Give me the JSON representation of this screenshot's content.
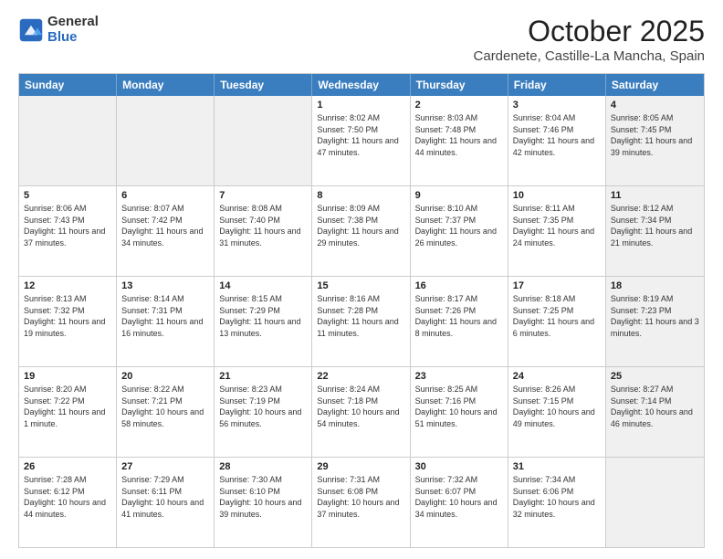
{
  "logo": {
    "general": "General",
    "blue": "Blue"
  },
  "title": "October 2025",
  "location": "Cardenete, Castille-La Mancha, Spain",
  "header_days": [
    "Sunday",
    "Monday",
    "Tuesday",
    "Wednesday",
    "Thursday",
    "Friday",
    "Saturday"
  ],
  "weeks": [
    [
      {
        "day": "",
        "text": "",
        "shaded": true
      },
      {
        "day": "",
        "text": "",
        "shaded": true
      },
      {
        "day": "",
        "text": "",
        "shaded": true
      },
      {
        "day": "1",
        "text": "Sunrise: 8:02 AM\nSunset: 7:50 PM\nDaylight: 11 hours and 47 minutes."
      },
      {
        "day": "2",
        "text": "Sunrise: 8:03 AM\nSunset: 7:48 PM\nDaylight: 11 hours and 44 minutes."
      },
      {
        "day": "3",
        "text": "Sunrise: 8:04 AM\nSunset: 7:46 PM\nDaylight: 11 hours and 42 minutes."
      },
      {
        "day": "4",
        "text": "Sunrise: 8:05 AM\nSunset: 7:45 PM\nDaylight: 11 hours and 39 minutes.",
        "shaded": true
      }
    ],
    [
      {
        "day": "5",
        "text": "Sunrise: 8:06 AM\nSunset: 7:43 PM\nDaylight: 11 hours and 37 minutes."
      },
      {
        "day": "6",
        "text": "Sunrise: 8:07 AM\nSunset: 7:42 PM\nDaylight: 11 hours and 34 minutes."
      },
      {
        "day": "7",
        "text": "Sunrise: 8:08 AM\nSunset: 7:40 PM\nDaylight: 11 hours and 31 minutes."
      },
      {
        "day": "8",
        "text": "Sunrise: 8:09 AM\nSunset: 7:38 PM\nDaylight: 11 hours and 29 minutes."
      },
      {
        "day": "9",
        "text": "Sunrise: 8:10 AM\nSunset: 7:37 PM\nDaylight: 11 hours and 26 minutes."
      },
      {
        "day": "10",
        "text": "Sunrise: 8:11 AM\nSunset: 7:35 PM\nDaylight: 11 hours and 24 minutes."
      },
      {
        "day": "11",
        "text": "Sunrise: 8:12 AM\nSunset: 7:34 PM\nDaylight: 11 hours and 21 minutes.",
        "shaded": true
      }
    ],
    [
      {
        "day": "12",
        "text": "Sunrise: 8:13 AM\nSunset: 7:32 PM\nDaylight: 11 hours and 19 minutes."
      },
      {
        "day": "13",
        "text": "Sunrise: 8:14 AM\nSunset: 7:31 PM\nDaylight: 11 hours and 16 minutes."
      },
      {
        "day": "14",
        "text": "Sunrise: 8:15 AM\nSunset: 7:29 PM\nDaylight: 11 hours and 13 minutes."
      },
      {
        "day": "15",
        "text": "Sunrise: 8:16 AM\nSunset: 7:28 PM\nDaylight: 11 hours and 11 minutes."
      },
      {
        "day": "16",
        "text": "Sunrise: 8:17 AM\nSunset: 7:26 PM\nDaylight: 11 hours and 8 minutes."
      },
      {
        "day": "17",
        "text": "Sunrise: 8:18 AM\nSunset: 7:25 PM\nDaylight: 11 hours and 6 minutes."
      },
      {
        "day": "18",
        "text": "Sunrise: 8:19 AM\nSunset: 7:23 PM\nDaylight: 11 hours and 3 minutes.",
        "shaded": true
      }
    ],
    [
      {
        "day": "19",
        "text": "Sunrise: 8:20 AM\nSunset: 7:22 PM\nDaylight: 11 hours and 1 minute."
      },
      {
        "day": "20",
        "text": "Sunrise: 8:22 AM\nSunset: 7:21 PM\nDaylight: 10 hours and 58 minutes."
      },
      {
        "day": "21",
        "text": "Sunrise: 8:23 AM\nSunset: 7:19 PM\nDaylight: 10 hours and 56 minutes."
      },
      {
        "day": "22",
        "text": "Sunrise: 8:24 AM\nSunset: 7:18 PM\nDaylight: 10 hours and 54 minutes."
      },
      {
        "day": "23",
        "text": "Sunrise: 8:25 AM\nSunset: 7:16 PM\nDaylight: 10 hours and 51 minutes."
      },
      {
        "day": "24",
        "text": "Sunrise: 8:26 AM\nSunset: 7:15 PM\nDaylight: 10 hours and 49 minutes."
      },
      {
        "day": "25",
        "text": "Sunrise: 8:27 AM\nSunset: 7:14 PM\nDaylight: 10 hours and 46 minutes.",
        "shaded": true
      }
    ],
    [
      {
        "day": "26",
        "text": "Sunrise: 7:28 AM\nSunset: 6:12 PM\nDaylight: 10 hours and 44 minutes."
      },
      {
        "day": "27",
        "text": "Sunrise: 7:29 AM\nSunset: 6:11 PM\nDaylight: 10 hours and 41 minutes."
      },
      {
        "day": "28",
        "text": "Sunrise: 7:30 AM\nSunset: 6:10 PM\nDaylight: 10 hours and 39 minutes."
      },
      {
        "day": "29",
        "text": "Sunrise: 7:31 AM\nSunset: 6:08 PM\nDaylight: 10 hours and 37 minutes."
      },
      {
        "day": "30",
        "text": "Sunrise: 7:32 AM\nSunset: 6:07 PM\nDaylight: 10 hours and 34 minutes."
      },
      {
        "day": "31",
        "text": "Sunrise: 7:34 AM\nSunset: 6:06 PM\nDaylight: 10 hours and 32 minutes."
      },
      {
        "day": "",
        "text": "",
        "shaded": true
      }
    ]
  ]
}
